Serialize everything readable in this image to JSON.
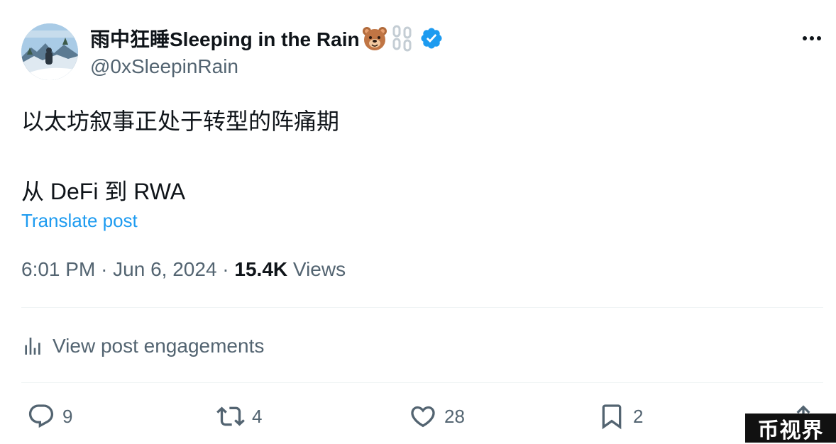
{
  "author": {
    "display_name": "雨中狂睡Sleeping in the Rain",
    "handle": "@0xSleepinRain",
    "avatar_icon": "avatar-landscape",
    "badge_icons": [
      "bear-emoji-icon",
      "chain-emoji-icon",
      "verified-badge-icon"
    ],
    "verified_color": "#1d9bf0"
  },
  "post": {
    "lines": [
      "以太坊叙事正处于转型的阵痛期",
      "从 DeFi 到 RWA"
    ],
    "translate_label": "Translate post"
  },
  "meta": {
    "time": "6:01 PM",
    "date": "Jun 6, 2024",
    "separator": "·",
    "views_count": "15.4K",
    "views_label": "Views"
  },
  "engagements": {
    "label": "View post engagements"
  },
  "actions": {
    "replies": "9",
    "reposts": "4",
    "likes": "28",
    "bookmarks": "2"
  },
  "watermark": {
    "text": "币视界"
  },
  "colors": {
    "link": "#1d9bf0",
    "secondary_text": "#536471",
    "primary_text": "#0f1419"
  }
}
